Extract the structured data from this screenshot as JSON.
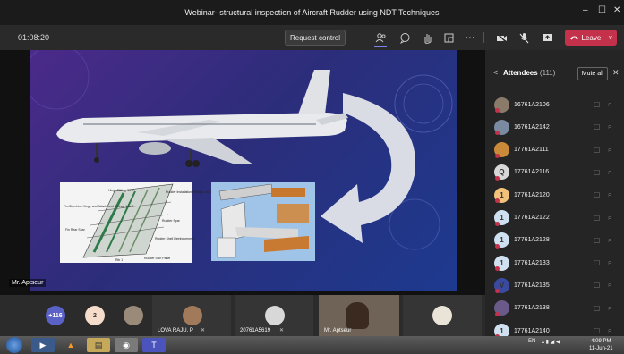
{
  "window": {
    "title": "Webinar- structural inspection of Aircraft Rudder using NDT Techniques",
    "minimize": "–",
    "maximize": "☐",
    "close": "✕"
  },
  "toolbar": {
    "timer": "01:08:20",
    "request_control": "Request control",
    "more": "···",
    "leave": "Leave",
    "leave_chevron": "∨"
  },
  "stage": {
    "presenter_label": "Mr. Aptseur"
  },
  "slide": {
    "diagram_labels": [
      "Hinge Fitting No. 7",
      "Rudder Installation Fittings 1 to 7",
      "Rudder Spar",
      "Fin Rear Spar",
      "Rudder Shell Reinforcement",
      "Rudder Skin Panel",
      "Rib 1",
      "Fin-Side-Link Hinge and Attachment Fittings 1 to 7"
    ]
  },
  "panel": {
    "back": "<",
    "title": "Attendees",
    "count": "(111)",
    "mute_all": "Mute all",
    "close": "✕",
    "attendees": [
      {
        "name": "16761A2106",
        "color": "#8a7a6a",
        "initial": ""
      },
      {
        "name": "16761A2142",
        "color": "#7a8aa0",
        "initial": ""
      },
      {
        "name": "17761A2111",
        "color": "#c98a3a",
        "initial": ""
      },
      {
        "name": "17761A2116",
        "color": "#d8d8d8",
        "initial": "Q"
      },
      {
        "name": "17761A2120",
        "color": "#f1c27a",
        "initial": "1"
      },
      {
        "name": "17761A2122",
        "color": "#cfe0f0",
        "initial": "1"
      },
      {
        "name": "17761A2128",
        "color": "#cfe0f0",
        "initial": "1"
      },
      {
        "name": "17761A2133",
        "color": "#cfe0f0",
        "initial": "1"
      },
      {
        "name": "17761A2135",
        "color": "#3a4aa0",
        "initial": "V"
      },
      {
        "name": "17761A2138",
        "color": "#6a5a8a",
        "initial": ""
      },
      {
        "name": "17761A2140",
        "color": "#cfe0f0",
        "initial": "1"
      }
    ]
  },
  "video_strip": {
    "overflow_count": "+116",
    "second_count": "2",
    "tiles": [
      {
        "name": "LOVA RAJU. P"
      },
      {
        "name": "20761A5619"
      },
      {
        "name": "Mr. Aptseur"
      },
      {
        "name": ""
      }
    ]
  },
  "taskbar": {
    "language": "EN",
    "time": "4:09 PM",
    "date": "11-Jun-21"
  }
}
